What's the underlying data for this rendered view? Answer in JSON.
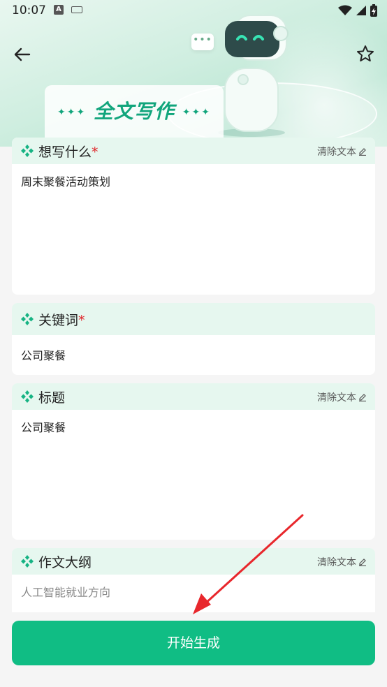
{
  "status_bar": {
    "time": "10:07",
    "notification_glyph": "A"
  },
  "header": {
    "title": "全文写作"
  },
  "fields": [
    {
      "label": "想写什么",
      "required": true,
      "clear_label": "清除文本",
      "value": "周末聚餐活动策划",
      "placeholder": ""
    },
    {
      "label": "关键词",
      "required": true,
      "clear_label": "",
      "value": "公司聚餐",
      "placeholder": ""
    },
    {
      "label": "标题",
      "required": false,
      "clear_label": "清除文本",
      "value": "公司聚餐",
      "placeholder": ""
    },
    {
      "label": "作文大纲",
      "required": false,
      "clear_label": "清除文本",
      "value": "",
      "placeholder": "人工智能就业方向"
    }
  ],
  "generate_button": {
    "label": "开始生成"
  },
  "colors": {
    "accent": "#10bd84",
    "header_bg": "#e6f7ef",
    "required": "#e0262a",
    "annotation_arrow": "#e8272c"
  },
  "icons": {
    "back": "arrow-left-icon",
    "favorite": "star-outline-icon",
    "field": "green-diamond-cluster-icon",
    "edit": "pencil-icon",
    "wifi": "wifi-icon",
    "signal": "signal-icon",
    "battery": "battery-charging-icon"
  }
}
